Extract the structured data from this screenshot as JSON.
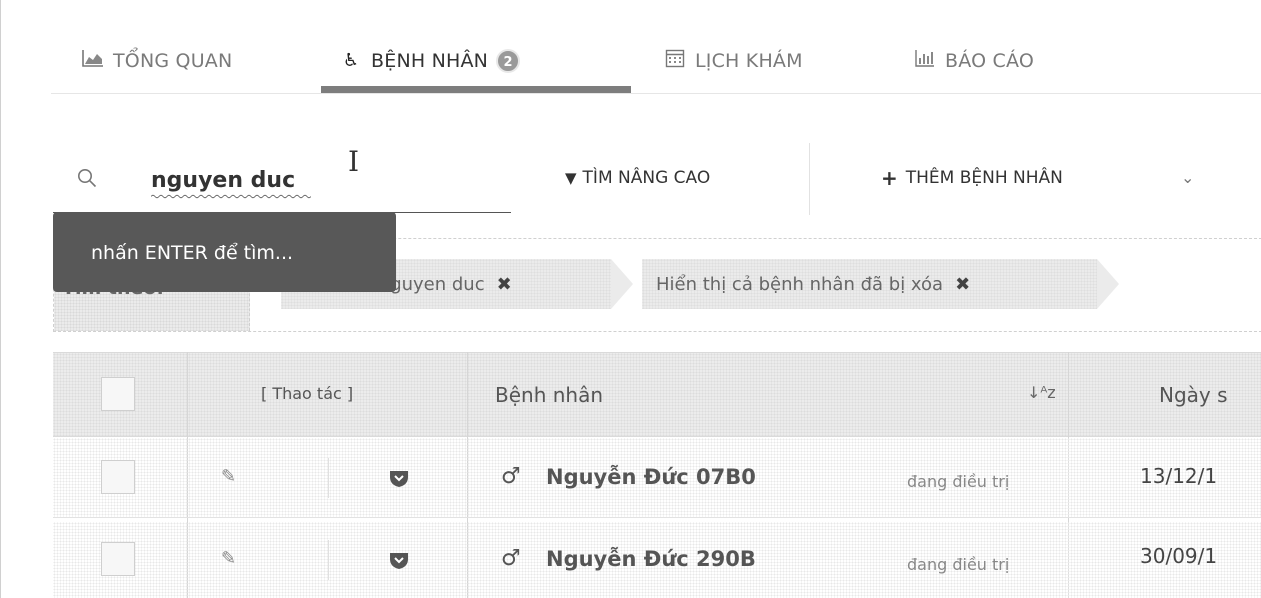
{
  "tabs": [
    {
      "label": "TỔNG QUAN",
      "icon": "area-chart-icon"
    },
    {
      "label": "BỆNH NHÂN",
      "icon": "wheelchair-icon",
      "badge": "2"
    },
    {
      "label": "LỊCH KHÁM",
      "icon": "calendar-icon"
    },
    {
      "label": "BÁO CÁO",
      "icon": "bar-chart-icon"
    }
  ],
  "search": {
    "value": "nguyen duc",
    "tooltip": "nhấn ENTER để tìm..."
  },
  "toolbar": {
    "advanced_search_label": "TÌM NÂNG CAO",
    "add_patient_label": "THÊM BỆNH NHÂN"
  },
  "filters": {
    "label": "Tìm theo:",
    "chips": [
      {
        "text": "Từ khóa: nguyen duc"
      },
      {
        "text": "Hiển thị cả bệnh nhân đã bị xóa"
      }
    ]
  },
  "table": {
    "columns": {
      "actions": "[ Thao tác ]",
      "patient": "Bệnh nhân",
      "sort_icon": "↓A/Z",
      "dob": "Ngày s"
    },
    "rows": [
      {
        "name": "Nguyễn Đức 07B0",
        "status": "đang điều trị",
        "date": "13/12/1",
        "gender": "male"
      },
      {
        "name": "Nguyễn Đức 290B",
        "status": "đang điều trị",
        "date": "30/09/1",
        "gender": "male"
      }
    ]
  },
  "colors": {
    "tooltip_bg": "#585858",
    "active_underline": "#7d7d7d",
    "header_bg": "#ececec"
  }
}
